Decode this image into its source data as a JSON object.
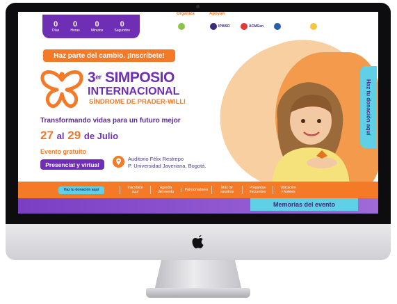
{
  "countdown": [
    {
      "value": "0",
      "label": "Días"
    },
    {
      "value": "0",
      "label": "Horas"
    },
    {
      "value": "0",
      "label": "Minutos"
    },
    {
      "value": "0",
      "label": "Segundos"
    }
  ],
  "sponsors": {
    "organiza_label": "Organiza",
    "apoyan_label": "Apoyan",
    "logos": [
      "IPWSO",
      "ACMGen"
    ]
  },
  "hero": {
    "cta": "Haz parte del cambio. ¡Inscríbete!",
    "ordinal": "3",
    "ordinal_suffix": "er",
    "title_line1": "SIMPOSIO",
    "title_line2": "INTERNACIONAL",
    "title_line3": "SÍNDROME DE PRADER-WILLI",
    "tagline": "Transformando vidas para un futuro mejor",
    "date_start": "27",
    "date_mid": "al",
    "date_end": "29",
    "date_month": "de Julio",
    "free": "Evento gratuito",
    "mode": "Presencial y virtual",
    "venue_line1": "Auditorio Félix Restrepo",
    "venue_line2": "P. Universidad Javeriana, Bogotá."
  },
  "donate_tab": "Haz tu donación aquí",
  "nav": {
    "donate": "Haz tu donación aquí",
    "items": [
      [
        "Inscríbete",
        "aquí"
      ],
      [
        "Agenda",
        "del evento"
      ],
      [
        "Patrocinadores",
        ""
      ],
      [
        "Más de",
        "nosotros"
      ],
      [
        "Preguntas",
        "frecuentes"
      ],
      [
        "Ubicación",
        "y hoteles"
      ]
    ]
  },
  "memories_button": "Memorias del evento",
  "colors": {
    "purple": "#6f2fb5",
    "orange": "#f47a28",
    "cyan": "#5fd0e6"
  }
}
